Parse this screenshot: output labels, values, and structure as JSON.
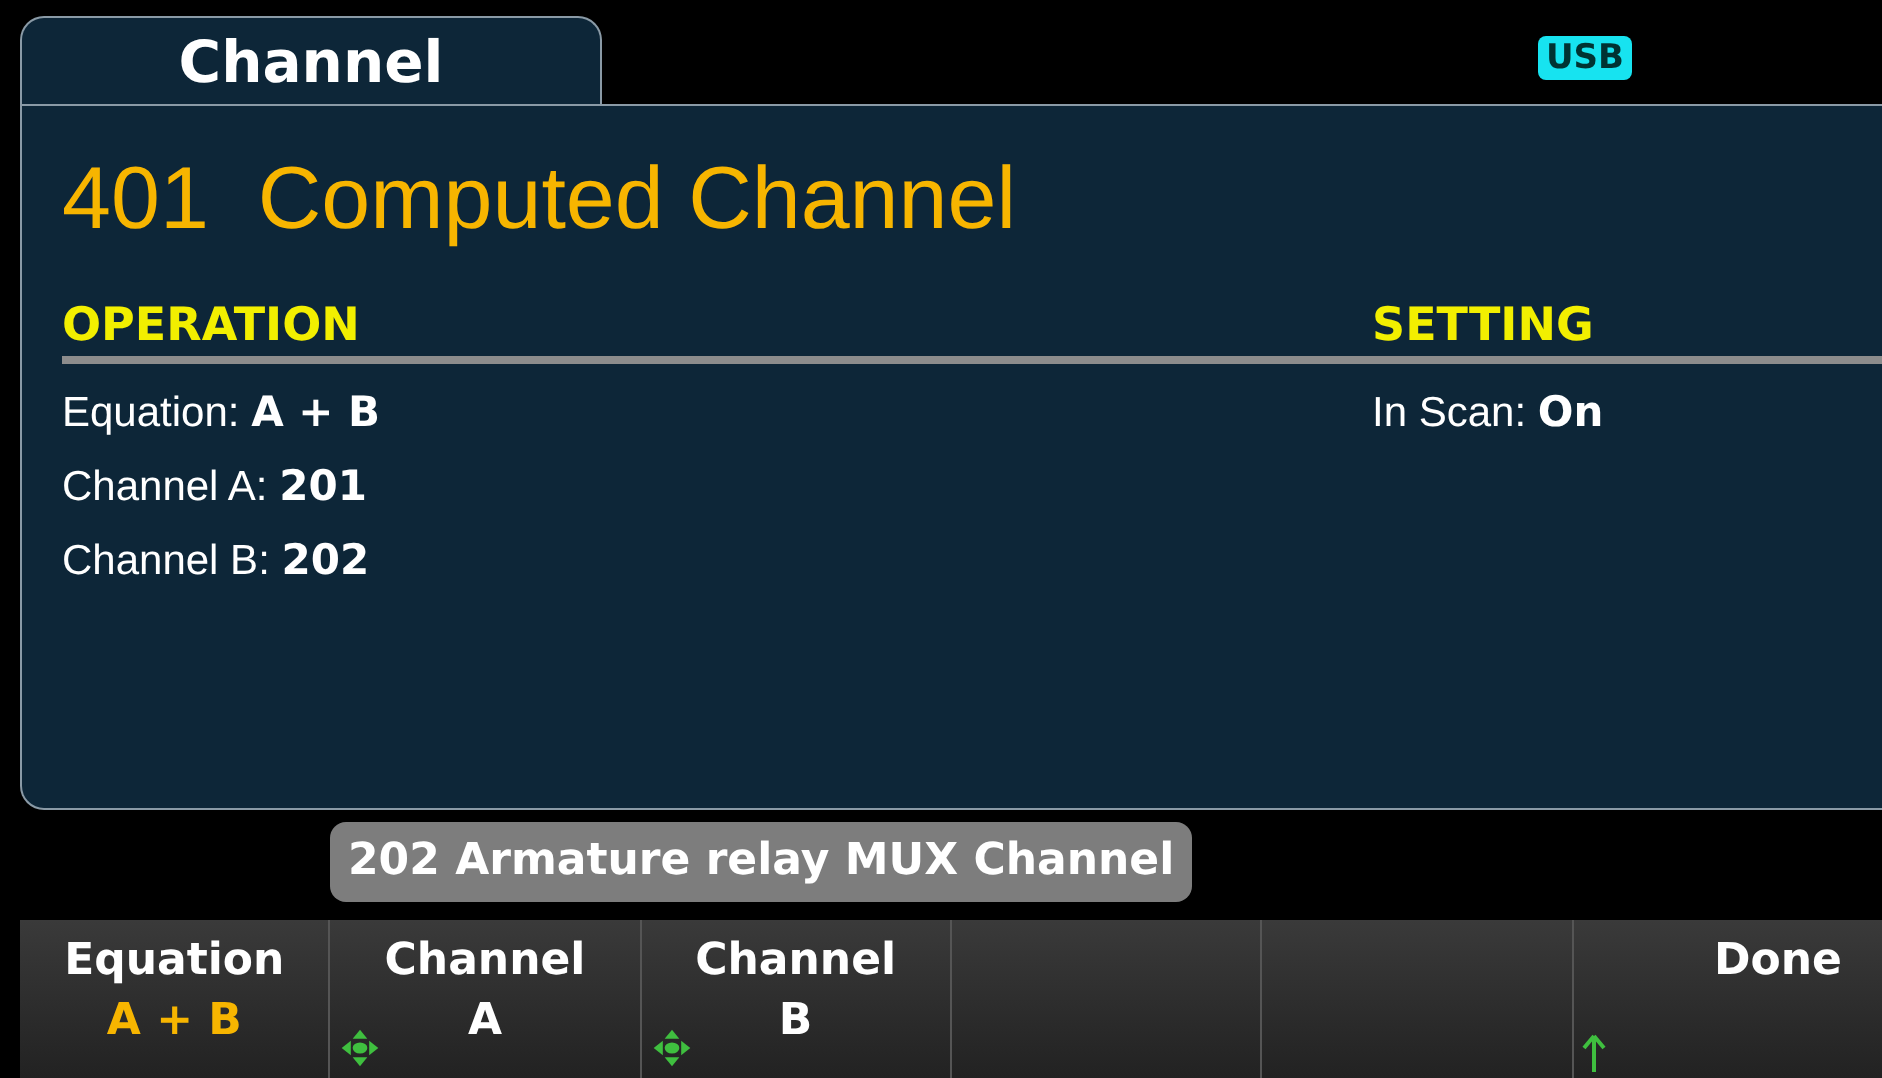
{
  "tab": {
    "label": "Channel",
    "selected": true
  },
  "status": {
    "badge": "USB"
  },
  "title": "401  Computed Channel",
  "operation": {
    "heading": "OPERATION",
    "lines": [
      "Equation: **A + B**",
      "Channel A: **201**",
      "Channel B: **202**"
    ]
  },
  "setting": {
    "heading": "SETTING",
    "lines": [
      "In Scan: **On**"
    ]
  },
  "tooltip": "202 Armature relay MUX Channel",
  "softkeys": [
    {
      "kind": "value",
      "label": "Equation",
      "value": "A + B"
    },
    {
      "kind": "knob",
      "label": "Channel",
      "value": "A"
    },
    {
      "kind": "knob",
      "label": "Channel",
      "value": "B"
    },
    {
      "kind": "blank"
    },
    {
      "kind": "blank"
    },
    {
      "kind": "back",
      "label": "Done"
    }
  ]
}
